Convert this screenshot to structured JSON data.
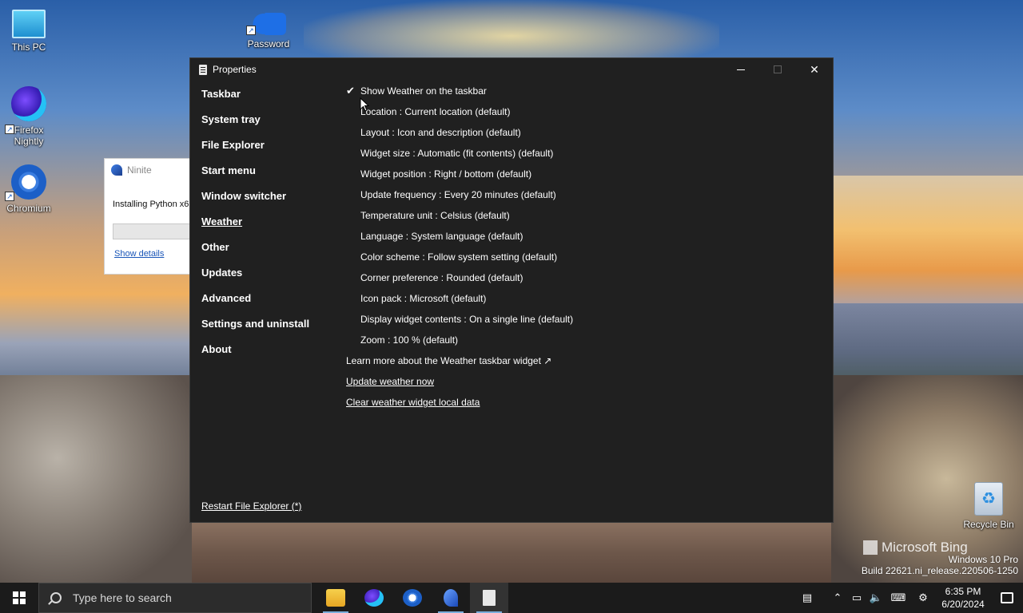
{
  "desktop": {
    "icons": [
      {
        "label": "This PC"
      },
      {
        "label": "Password"
      },
      {
        "label": "Firefox\nNightly"
      },
      {
        "label": "Chromium"
      },
      {
        "label": "Recycle Bin"
      }
    ],
    "watermark": {
      "brand": "Microsoft Bing",
      "edition": "Windows 10 Pro",
      "build": "Build 22621.ni_release.220506-1250"
    }
  },
  "ninite": {
    "title": "Ninite",
    "status": "Installing Python x6",
    "details_link": "Show details"
  },
  "window": {
    "title": "Properties",
    "nav": [
      {
        "label": "Taskbar",
        "active": false
      },
      {
        "label": "System tray",
        "active": false
      },
      {
        "label": "File Explorer",
        "active": false
      },
      {
        "label": "Start menu",
        "active": false
      },
      {
        "label": "Window switcher",
        "active": false
      },
      {
        "label": "Weather",
        "active": true
      },
      {
        "label": "Other",
        "active": false
      },
      {
        "label": "Updates",
        "active": false
      },
      {
        "label": "Advanced",
        "active": false
      },
      {
        "label": "Settings and uninstall",
        "active": false
      },
      {
        "label": "About",
        "active": false
      }
    ],
    "restart_link": "Restart File Explorer (*)",
    "weather": {
      "show_checkbox": {
        "checked": true,
        "label": "Show Weather on the taskbar"
      },
      "options": [
        "Location : Current location (default)",
        "Layout : Icon and description (default)",
        "Widget size : Automatic (fit contents) (default)",
        "Widget position : Right / bottom (default)",
        "Update frequency : Every 20 minutes (default)",
        "Temperature unit : Celsius (default)",
        "Language : System language (default)",
        "Color scheme : Follow system setting (default)",
        "Corner preference : Rounded (default)",
        "Icon pack : Microsoft (default)",
        "Display widget contents : On a single line (default)",
        "Zoom : 100 % (default)"
      ],
      "learn_more": "Learn more about the Weather taskbar widget ↗",
      "update_now": "Update weather now",
      "clear_data": "Clear weather widget local data"
    }
  },
  "taskbar": {
    "search_placeholder": "Type here to search",
    "clock_time": "6:35 PM",
    "clock_date": "6/20/2024"
  }
}
